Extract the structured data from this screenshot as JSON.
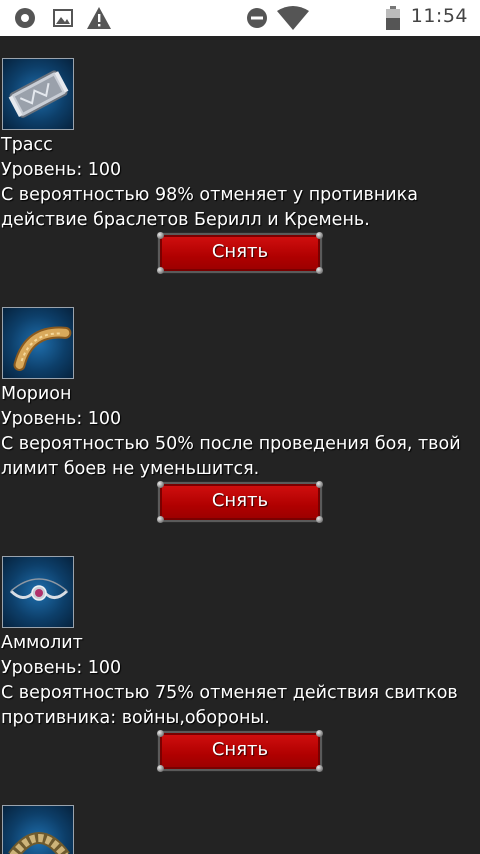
{
  "status_bar": {
    "time": "11:54",
    "icons": [
      "notification-circle-icon",
      "image-icon",
      "warning-icon",
      "do-not-disturb-icon",
      "wifi-icon",
      "battery-icon"
    ]
  },
  "items": [
    {
      "name": "Трасс",
      "level": "Уровень: 100",
      "description": "С вероятностью 98% отменяет у противника действие браслетов Берилл и Кремень.",
      "button_label": "Снять",
      "image": "silver-engraved-bracelet"
    },
    {
      "name": "Морион",
      "level": "Уровень: 100",
      "description": "С вероятностью 50% после проведения боя, твой лимит боев не уменьшится.",
      "button_label": "Снять",
      "image": "gold-cuff-bracelet"
    },
    {
      "name": "Аммолит",
      "level": "Уровень: 100",
      "description": "С вероятностью 75% отменяет действия свитков противника: войны,обороны.",
      "button_label": "Снять",
      "image": "silver-gem-bracelet"
    },
    {
      "image": "gold-chain-bracelet"
    }
  ]
}
